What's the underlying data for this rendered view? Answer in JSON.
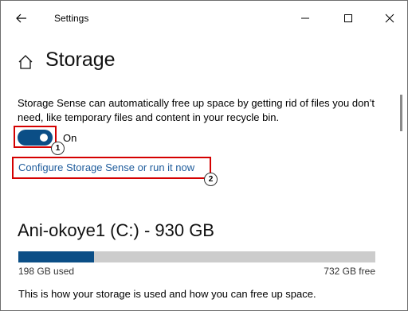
{
  "window": {
    "title": "Settings"
  },
  "page": {
    "title": "Storage"
  },
  "storage_sense": {
    "description": "Storage Sense can automatically free up space by getting rid of files you don’t need, like temporary files and content in your recycle bin.",
    "toggle_state": "On",
    "toggle_on": true,
    "configure_link": "Configure Storage Sense or run it now"
  },
  "callouts": {
    "one": "1",
    "two": "2"
  },
  "drive": {
    "title": "Ani-okoye1 (C:) - 930 GB",
    "used_label": "198 GB used",
    "free_label": "732 GB free",
    "used_fraction": 0.213
  },
  "footer": {
    "text": "This is how your storage is used and how you can free up space."
  },
  "colors": {
    "accent": "#0b4e86",
    "link": "#1f5c9c",
    "highlight": "#d40000",
    "bar_track": "#cccccc"
  },
  "icons": [
    "back-arrow-icon",
    "minimize-icon",
    "maximize-icon",
    "close-icon",
    "home-icon"
  ]
}
